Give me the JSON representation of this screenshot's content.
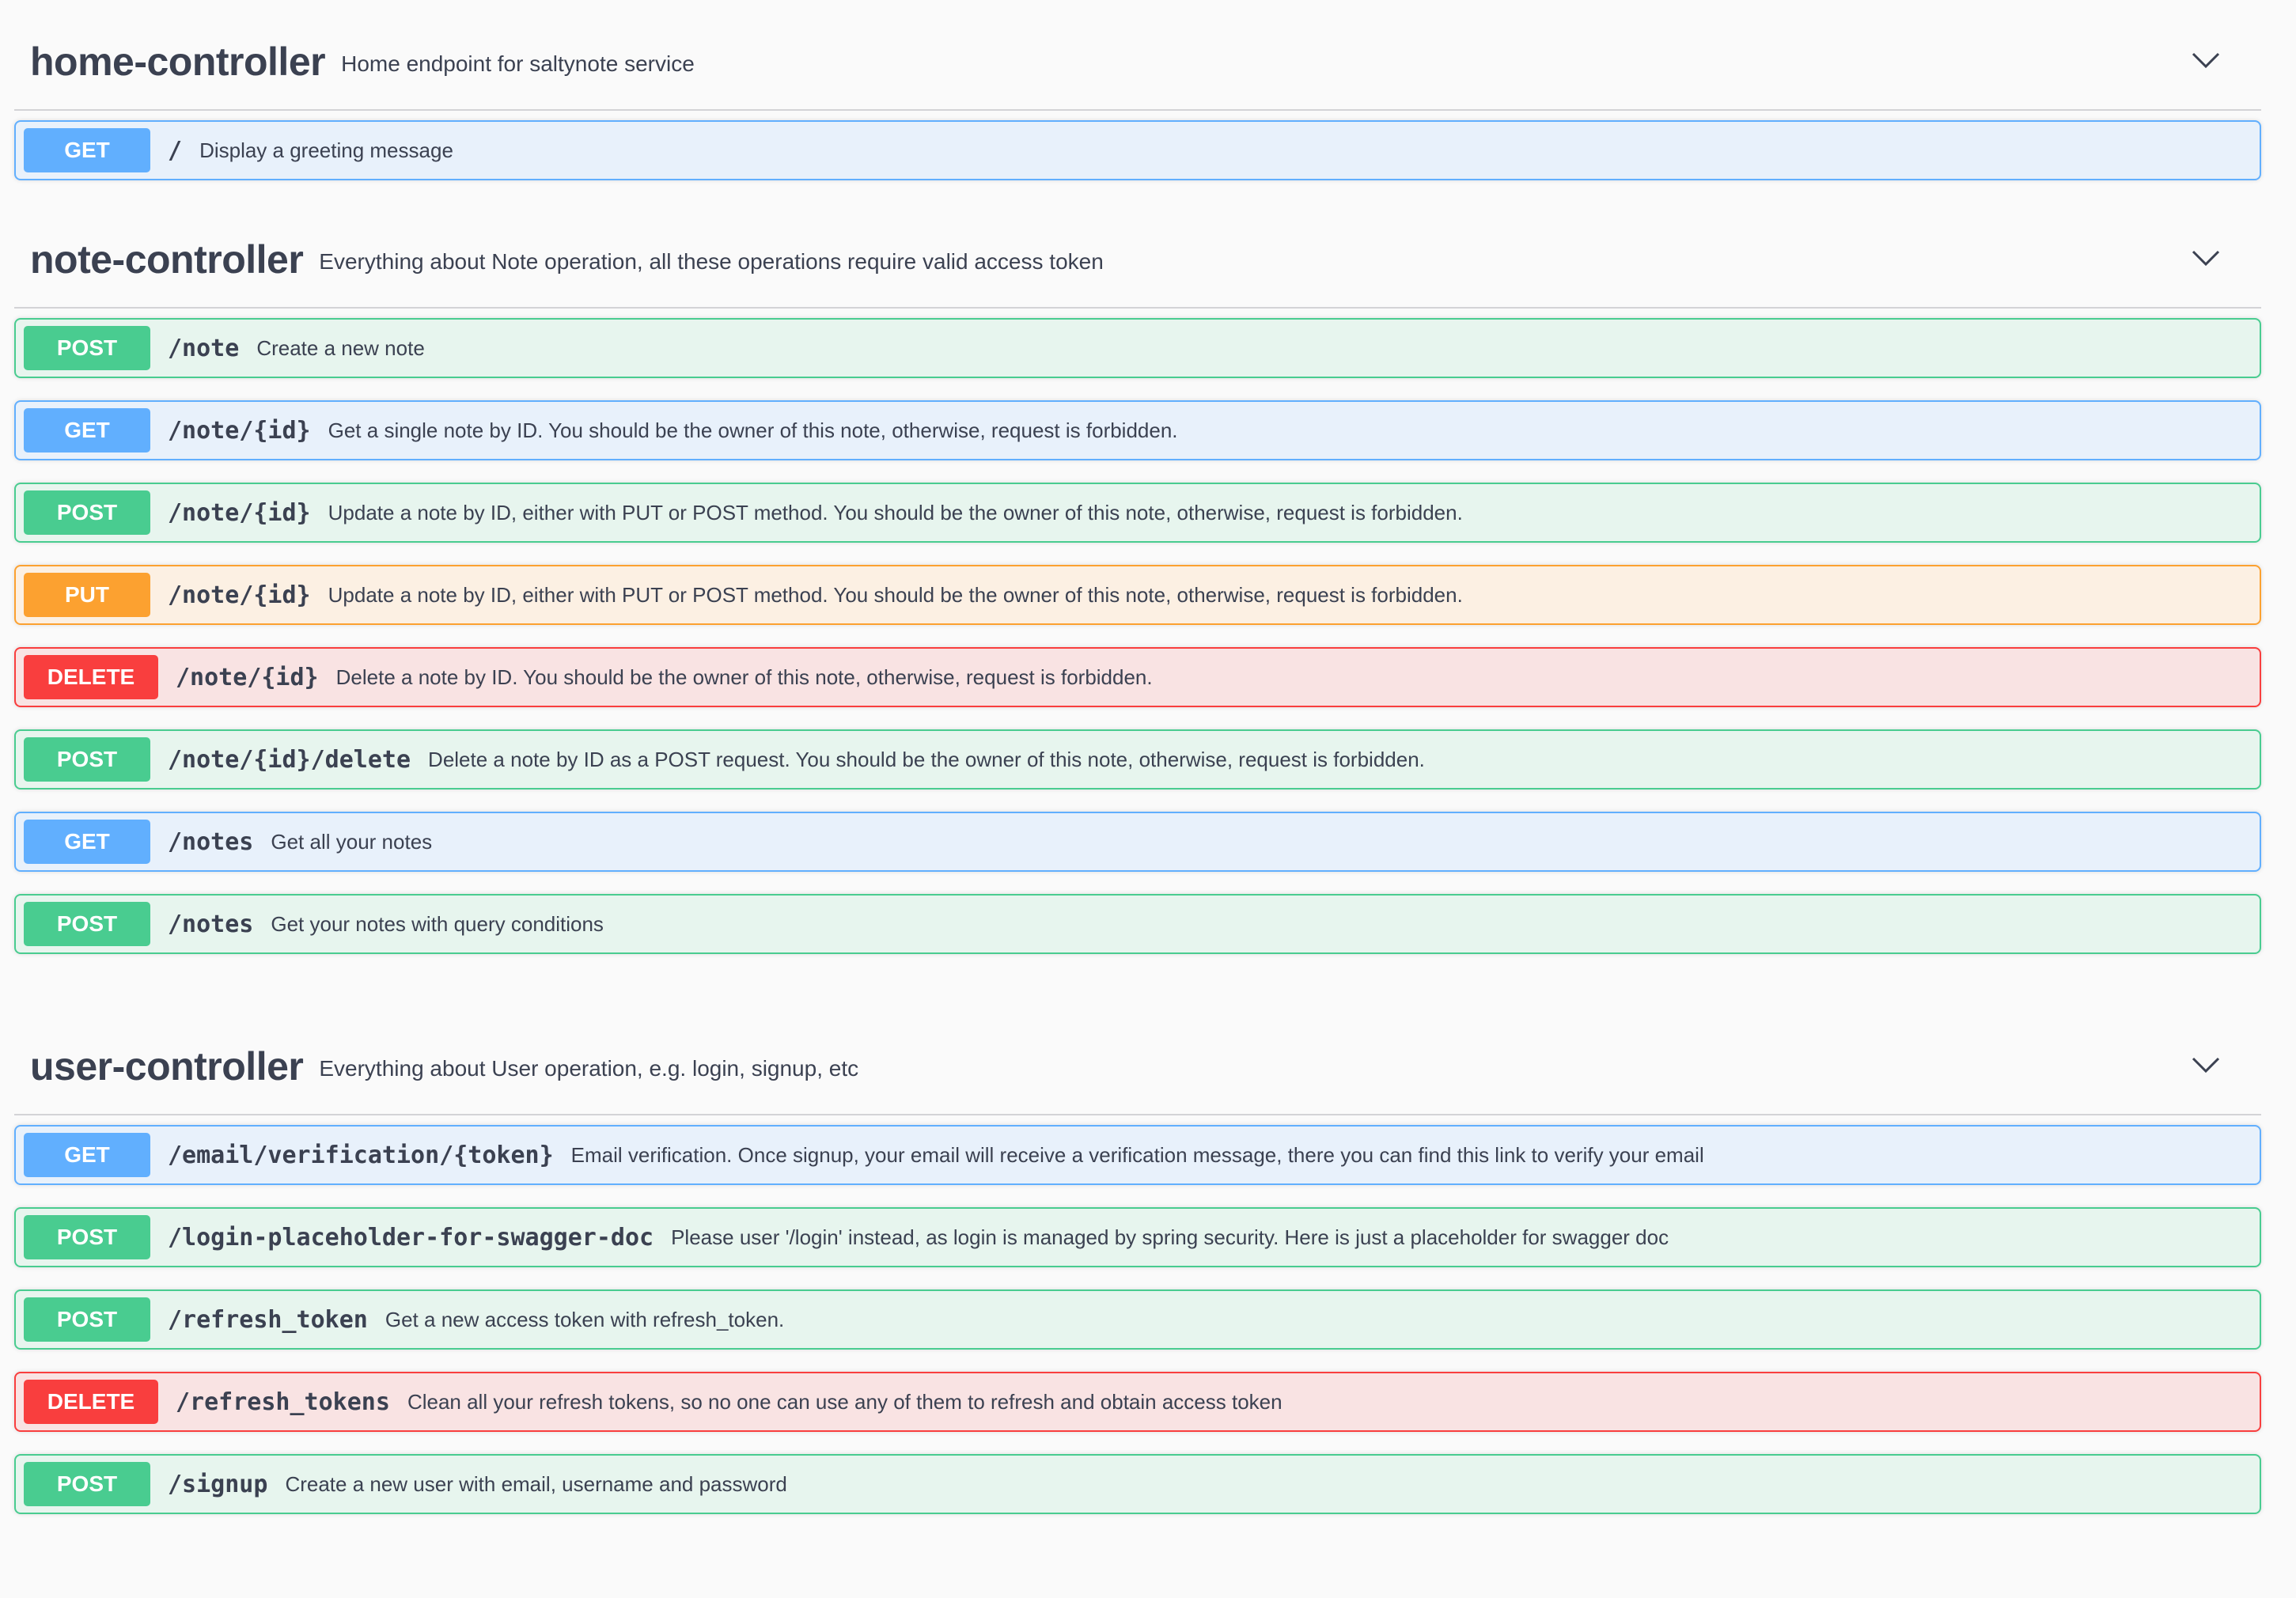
{
  "sections": [
    {
      "name": "home-controller",
      "description": "Home endpoint for saltynote service",
      "chevron_icon": "chevron-down-icon",
      "operations": [
        {
          "method": "GET",
          "path": "/",
          "summary": "Display a greeting message"
        }
      ]
    },
    {
      "name": "note-controller",
      "description": "Everything about Note operation, all these operations require valid access token",
      "chevron_icon": "chevron-down-icon",
      "operations": [
        {
          "method": "POST",
          "path": "/note",
          "summary": "Create a new note"
        },
        {
          "method": "GET",
          "path": "/note/{id}",
          "summary": "Get a single note by ID. You should be the owner of this note, otherwise, request is forbidden."
        },
        {
          "method": "POST",
          "path": "/note/{id}",
          "summary": "Update a note by ID, either with PUT or POST method. You should be the owner of this note, otherwise, request is forbidden."
        },
        {
          "method": "PUT",
          "path": "/note/{id}",
          "summary": "Update a note by ID, either with PUT or POST method. You should be the owner of this note, otherwise, request is forbidden."
        },
        {
          "method": "DELETE",
          "path": "/note/{id}",
          "summary": "Delete a note by ID. You should be the owner of this note, otherwise, request is forbidden."
        },
        {
          "method": "POST",
          "path": "/note/{id}/delete",
          "summary": "Delete a note by ID as a POST request. You should be the owner of this note, otherwise, request is forbidden."
        },
        {
          "method": "GET",
          "path": "/notes",
          "summary": "Get all your notes"
        },
        {
          "method": "POST",
          "path": "/notes",
          "summary": "Get your notes with query conditions"
        }
      ]
    },
    {
      "name": "user-controller",
      "description": "Everything about User operation, e.g. login, signup, etc",
      "chevron_icon": "chevron-down-icon",
      "operations": [
        {
          "method": "GET",
          "path": "/email/verification/{token}",
          "summary": "Email verification. Once signup, your email will receive a verification message, there you can find this link to verify your email"
        },
        {
          "method": "POST",
          "path": "/login-placeholder-for-swagger-doc",
          "summary": "Please user '/login' instead, as login is managed by spring security. Here is just a placeholder for swagger doc"
        },
        {
          "method": "POST",
          "path": "/refresh_token",
          "summary": "Get a new access token with refresh_token."
        },
        {
          "method": "DELETE",
          "path": "/refresh_tokens",
          "summary": "Clean all your refresh tokens, so no one can use any of them to refresh and obtain access token"
        },
        {
          "method": "POST",
          "path": "/signup",
          "summary": "Create a new user with email, username and password"
        }
      ]
    }
  ],
  "colors": {
    "GET": "#61affe",
    "POST": "#49cc90",
    "PUT": "#fca130",
    "DELETE": "#f93e3e",
    "text": "#3b4151",
    "background": "#fafafa"
  }
}
